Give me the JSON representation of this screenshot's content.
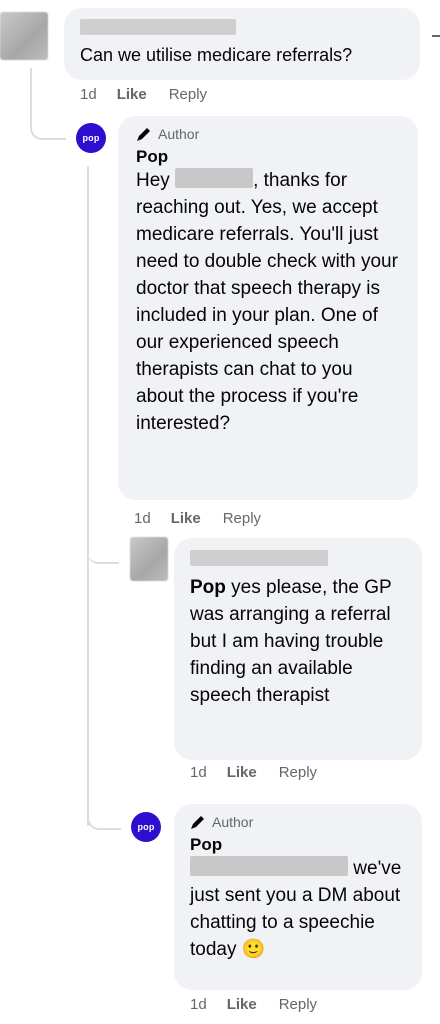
{
  "comment1": {
    "text": "Can we utilise medicare referrals?",
    "time": "1d",
    "like": "Like",
    "reply": "Reply"
  },
  "reply1": {
    "avatar_text": "pop",
    "author_badge": "Author",
    "name": "Pop",
    "text_before": "Hey",
    "text_after": ", thanks for reaching out. Yes, we accept medicare referrals. You'll just need to double check with your doctor that speech therapy is included in your plan. One of our experienced speech therapists can chat to you about the process if you're interested?",
    "time": "1d",
    "like": "Like",
    "reply": "Reply"
  },
  "reply2": {
    "mention": "Pop",
    "text": " yes please, the GP was arranging a referral but I am having trouble finding an available speech therapist",
    "time": "1d",
    "like": "Like",
    "reply": "Reply"
  },
  "reply3": {
    "avatar_text": "pop",
    "author_badge": "Author",
    "name": "Pop",
    "text": "we've just sent you a DM about chatting to a speechie today",
    "emoji": "🙂",
    "time": "1d",
    "like": "Like",
    "reply": "Reply"
  },
  "colors": {
    "bubble": "#f0f2f5",
    "brand": "#2e0fd0",
    "meta": "#65676b"
  }
}
